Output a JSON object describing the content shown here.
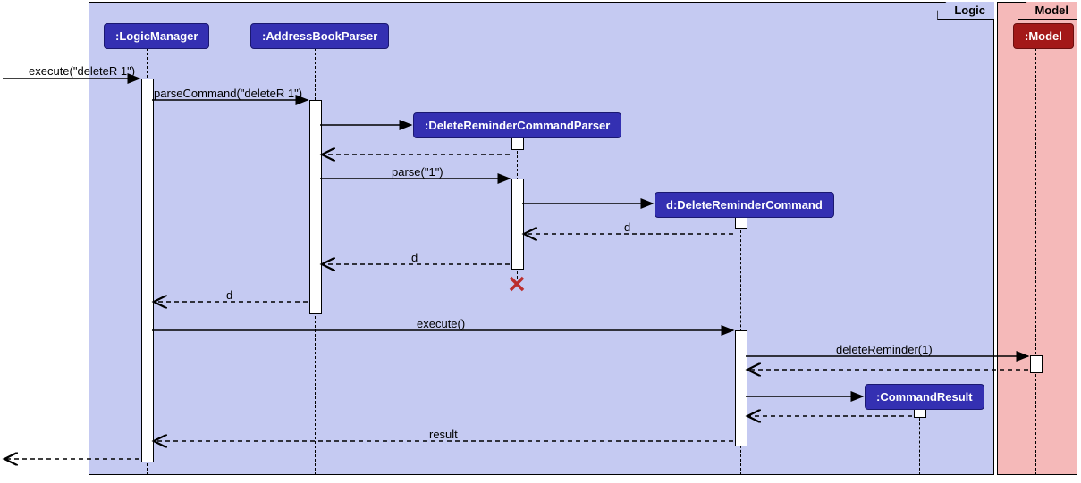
{
  "packages": {
    "logic": "Logic",
    "model": "Model"
  },
  "participants": {
    "logicManager": ":LogicManager",
    "addressBookParser": ":AddressBookParser",
    "deleteReminderCommandParser": ":DeleteReminderCommandParser",
    "deleteReminderCommand": "d:DeleteReminderCommand",
    "commandResult": ":CommandResult",
    "model": ":Model"
  },
  "messages": {
    "m1": "execute(\"deleteR 1\")",
    "m2": "parseCommand(\"deleteR 1\")",
    "m3": "parse(\"1\")",
    "m4": "d",
    "m5": "d",
    "m6": "d",
    "m7": "execute()",
    "m8": "deleteReminder(1)",
    "m9": "result"
  },
  "chart_data": {
    "type": "sequence_diagram",
    "packages": [
      {
        "name": "Logic",
        "participants": [
          "LogicManager",
          "AddressBookParser",
          "DeleteReminderCommandParser",
          "DeleteReminderCommand",
          "CommandResult"
        ]
      },
      {
        "name": "Model",
        "participants": [
          "Model"
        ]
      }
    ],
    "lifelines": [
      {
        "id": "LogicManager",
        "label": ":LogicManager"
      },
      {
        "id": "AddressBookParser",
        "label": ":AddressBookParser"
      },
      {
        "id": "DeleteReminderCommandParser",
        "label": ":DeleteReminderCommandParser",
        "created_by": "AddressBookParser"
      },
      {
        "id": "DeleteReminderCommand",
        "label": "d:DeleteReminderCommand",
        "created_by": "DeleteReminderCommandParser"
      },
      {
        "id": "CommandResult",
        "label": ":CommandResult",
        "created_by": "DeleteReminderCommand"
      },
      {
        "id": "Model",
        "label": ":Model"
      }
    ],
    "messages": [
      {
        "from": "caller",
        "to": "LogicManager",
        "label": "execute(\"deleteR 1\")",
        "type": "sync"
      },
      {
        "from": "LogicManager",
        "to": "AddressBookParser",
        "label": "parseCommand(\"deleteR 1\")",
        "type": "sync"
      },
      {
        "from": "AddressBookParser",
        "to": "DeleteReminderCommandParser",
        "label": "",
        "type": "create"
      },
      {
        "from": "DeleteReminderCommandParser",
        "to": "AddressBookParser",
        "label": "",
        "type": "return"
      },
      {
        "from": "AddressBookParser",
        "to": "DeleteReminderCommandParser",
        "label": "parse(\"1\")",
        "type": "sync"
      },
      {
        "from": "DeleteReminderCommandParser",
        "to": "DeleteReminderCommand",
        "label": "",
        "type": "create"
      },
      {
        "from": "DeleteReminderCommand",
        "to": "DeleteReminderCommandParser",
        "label": "d",
        "type": "return"
      },
      {
        "from": "DeleteReminderCommandParser",
        "to": "AddressBookParser",
        "label": "d",
        "type": "return"
      },
      {
        "from": "DeleteReminderCommandParser",
        "to": null,
        "label": "",
        "type": "destroy"
      },
      {
        "from": "AddressBookParser",
        "to": "LogicManager",
        "label": "d",
        "type": "return"
      },
      {
        "from": "LogicManager",
        "to": "DeleteReminderCommand",
        "label": "execute()",
        "type": "sync"
      },
      {
        "from": "DeleteReminderCommand",
        "to": "Model",
        "label": "deleteReminder(1)",
        "type": "sync"
      },
      {
        "from": "Model",
        "to": "DeleteReminderCommand",
        "label": "",
        "type": "return"
      },
      {
        "from": "DeleteReminderCommand",
        "to": "CommandResult",
        "label": "",
        "type": "create"
      },
      {
        "from": "CommandResult",
        "to": "DeleteReminderCommand",
        "label": "",
        "type": "return"
      },
      {
        "from": "DeleteReminderCommand",
        "to": "LogicManager",
        "label": "result",
        "type": "return"
      },
      {
        "from": "LogicManager",
        "to": "caller",
        "label": "",
        "type": "return"
      }
    ]
  }
}
